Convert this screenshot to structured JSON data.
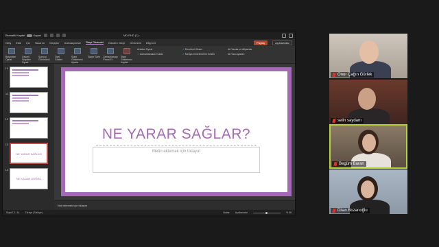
{
  "ppt": {
    "autosave_label": "Otomatik Kaydet",
    "autosave_state": "Kapalı",
    "doc_name": "MD PHD (1) -",
    "tabs": [
      "Giriş",
      "Ekle",
      "Çiz",
      "Tasarım",
      "Geçişler",
      "Animasyonlar",
      "Slayt Gösterisi",
      "Gözden Geçir",
      "Görünüm",
      "Bilgi ver"
    ],
    "active_tab": "Slayt Gösterisi",
    "share_label": "Paylaş",
    "comments_label": "Açıklamalar",
    "ribbon_buttons": [
      {
        "label": "Başından Oynat"
      },
      {
        "label": "Geçerli Slayttan Oynat"
      },
      {
        "label": "Sunucu Görünümü"
      },
      {
        "label": "Özel Gösteri"
      },
      {
        "label": "Slayt Gösterisini Ayarla"
      },
      {
        "label": "Slaytı Gizle"
      },
      {
        "label": "Zamanlamayı Prova Et"
      },
      {
        "label": "Slayt Gösterisini Kaydet"
      }
    ],
    "ribbon_options": {
      "col1": [
        "Anlatım Oynat",
        "Zamanlamaları Kullan"
      ],
      "col2": [
        "Denetimi Göster",
        "Medya Denetimlerini Göster"
      ],
      "col3": [
        "Alt Yazılar ve Altyazılar",
        "Alt Yazı Ayarları"
      ]
    },
    "thumbnails": [
      {
        "num": "10",
        "title": ""
      },
      {
        "num": "11",
        "title": ""
      },
      {
        "num": "12",
        "title": ""
      },
      {
        "num": "13",
        "title": "NE YARAR SAĞLAR"
      },
      {
        "num": "14",
        "title": "NE KADAR DOĞRU"
      }
    ],
    "slide": {
      "title": "NE YARAR SAĞLAR?",
      "content_placeholder": "Metin eklemek için tıklayın"
    },
    "notes_placeholder": "Not eklemek için tıklayın",
    "status": {
      "slide_counter": "Slayt 13 / 14",
      "language": "Türkçe (Türkiye)",
      "notes_btn": "Notlar",
      "comments_btn": "Açıklamalar",
      "zoom": "% 58"
    }
  },
  "participants": [
    {
      "name": "Onur Çağın Gürlek",
      "muted": true,
      "speaking": false
    },
    {
      "name": "selin saydam",
      "muted": true,
      "speaking": false
    },
    {
      "name": "Begüm Baran",
      "muted": true,
      "speaking": true
    },
    {
      "name": "Dilan Bozanoğlu",
      "muted": true,
      "speaking": false
    }
  ],
  "colors": {
    "slide_accent": "#a56ab5",
    "active_speaker_border": "#b5d334",
    "share_button": "#b7472a",
    "mute_icon": "#d9352f"
  }
}
